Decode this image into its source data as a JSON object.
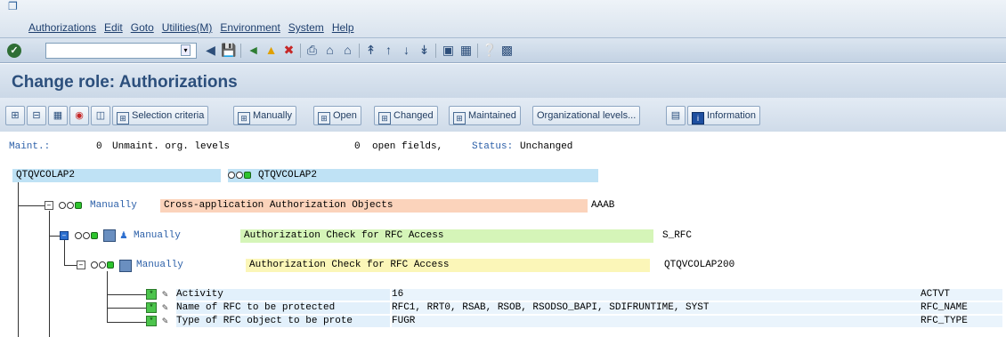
{
  "menubar": {
    "items": [
      "Authorizations",
      "Edit",
      "Goto",
      "Utilities(M)",
      "Environment",
      "System",
      "Help"
    ]
  },
  "system_toolbar": {
    "command_field_value": ""
  },
  "title": "Change role: Authorizations",
  "app_toolbar": {
    "selection_criteria": "Selection criteria",
    "manually": "Manually",
    "open": "Open",
    "changed": "Changed",
    "maintained": "Maintained",
    "org_levels": "Organizational levels...",
    "information": "Information"
  },
  "status": {
    "maint_label": "Maint.:",
    "unmaint_count": "0",
    "unmaint_text": "Unmaint. org. levels",
    "open_count": "0",
    "open_text": "open fields,",
    "status_label": "Status:",
    "status_value": "Unchanged"
  },
  "tree": {
    "root": {
      "name": "QTQVCOLAP2",
      "profile": "QTQVCOLAP2"
    },
    "class_node": {
      "mode": "Manually",
      "text": "Cross-application Authorization Objects",
      "code": "AAAB"
    },
    "object_node": {
      "mode": "Manually",
      "text": "Authorization Check for RFC Access",
      "code": "S_RFC"
    },
    "auth_node": {
      "mode": "Manually",
      "text": "Authorization Check for RFC Access",
      "code": "QTQVCOLAP200"
    },
    "fields": [
      {
        "label": "Activity",
        "value": "16",
        "name": "ACTVT"
      },
      {
        "label": "Name of RFC to be protected",
        "value": "RFC1, RRT0, RSAB, RSOB, RSODSO_BAPI, SDIFRUNTIME, SYST",
        "name": "RFC_NAME"
      },
      {
        "label": "Type of RFC object to be prote",
        "value": "FUGR",
        "name": "RFC_TYPE"
      }
    ]
  },
  "colors": {
    "root_bg": "#bfe2f5",
    "class_bg": "#fbd3bb",
    "object_bg": "#d5f5b8",
    "auth_bg": "#fbf6b8",
    "field_bg": "#e2f0fb"
  }
}
